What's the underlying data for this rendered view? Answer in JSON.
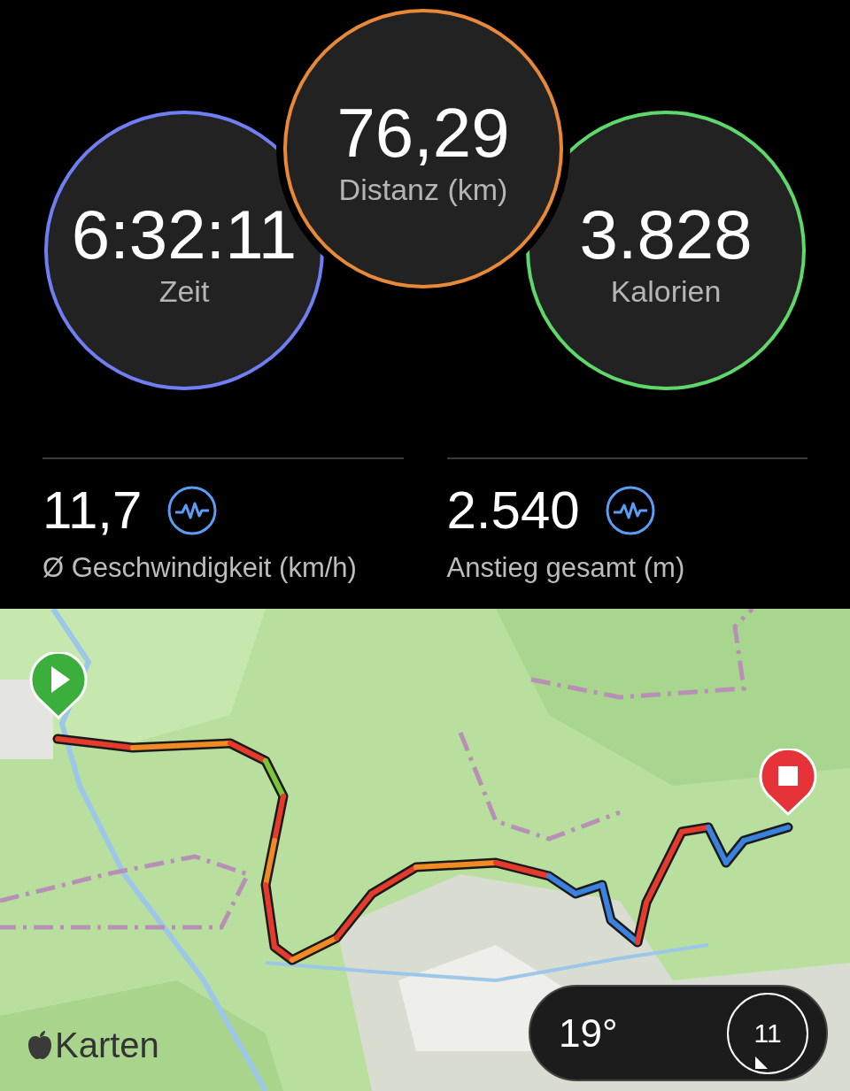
{
  "rings": [
    {
      "value": "6:32:11",
      "label": "Zeit",
      "color": "#6f7ff3"
    },
    {
      "value": "76,29",
      "label": "Distanz (km)",
      "color": "#e8893a"
    },
    {
      "value": "3.828",
      "label": "Kalorien",
      "color": "#5fd86a"
    }
  ],
  "metrics": [
    {
      "value": "11,7",
      "label": "Ø Geschwindigkeit (km/h)"
    },
    {
      "value": "2.540",
      "label": "Anstieg gesamt (m)"
    }
  ],
  "map": {
    "kind": "picture",
    "attribution": "Karten",
    "temperature": "19°",
    "compass": "11"
  }
}
